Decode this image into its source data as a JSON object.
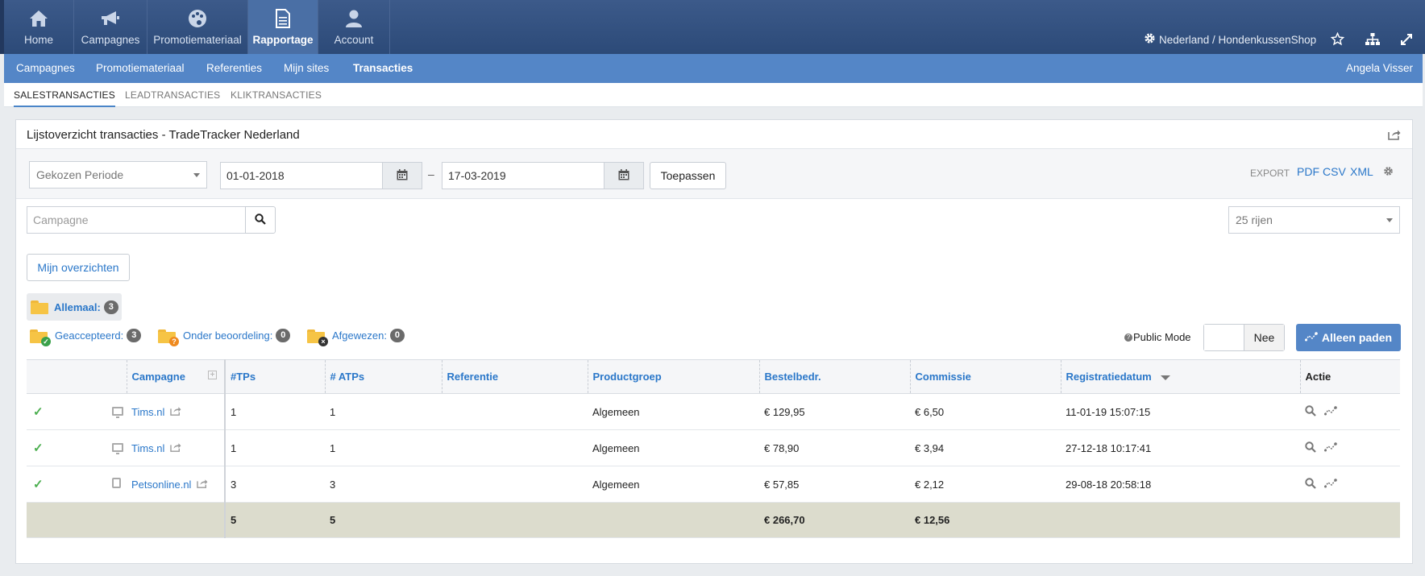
{
  "topnav": {
    "items": [
      {
        "label": "Home",
        "icon": "home-icon"
      },
      {
        "label": "Campagnes",
        "icon": "megaphone-icon"
      },
      {
        "label": "Promotiemateriaal",
        "icon": "palette-icon"
      },
      {
        "label": "Rapportage",
        "icon": "document-icon"
      },
      {
        "label": "Account",
        "icon": "user-icon"
      }
    ],
    "active": "Rapportage",
    "site_selector": "Nederland / HondenkussenShop"
  },
  "subnav": {
    "items": [
      "Campagnes",
      "Promotiemateriaal",
      "Referenties",
      "Mijn sites",
      "Transacties"
    ],
    "active": "Transacties",
    "user": "Angela Visser"
  },
  "tabs": [
    "SALESTRANSACTIES",
    "LEADTRANSACTIES",
    "KLIKTRANSACTIES"
  ],
  "panel": {
    "title": "Lijstoverzicht transacties - TradeTracker Nederland"
  },
  "filters": {
    "period": "Gekozen Periode",
    "date_from": "01-01-2018",
    "date_sep": "–",
    "date_to": "17-03-2019",
    "apply": "Toepassen",
    "export_label": "EXPORT",
    "export_pdf": "PDF",
    "export_csv": "CSV",
    "export_xml": "XML",
    "campaign_placeholder": "Campagne",
    "rows": "25 rijen",
    "my_overviews": "Mijn overzichten"
  },
  "statuses": {
    "all": {
      "label": "Allemaal:",
      "count": "3"
    },
    "accepted": {
      "label": "Geaccepteerd:",
      "count": "3"
    },
    "pending": {
      "label": "Onder beoordeling:",
      "count": "0"
    },
    "rejected": {
      "label": "Afgewezen:",
      "count": "0"
    }
  },
  "public_mode": {
    "label": "Public Mode",
    "value": "Nee"
  },
  "paths_button": "Alleen paden",
  "table": {
    "headers": [
      "Campagne",
      "#TPs",
      "# ATPs",
      "Referentie",
      "Productgroep",
      "Bestelbedr.",
      "Commissie",
      "Registratiedatum",
      "Actie"
    ],
    "rows": [
      {
        "device": "desktop",
        "campaign": "Tims.nl",
        "tps": "1",
        "atps": "1",
        "ref": "",
        "group": "Algemeen",
        "amount": "€ 129,95",
        "commission": "€ 6,50",
        "date": "11-01-19 15:07:15"
      },
      {
        "device": "desktop",
        "campaign": "Tims.nl",
        "tps": "1",
        "atps": "1",
        "ref": "",
        "group": "Algemeen",
        "amount": "€ 78,90",
        "commission": "€ 3,94",
        "date": "27-12-18 10:17:41"
      },
      {
        "device": "tablet",
        "campaign": "Petsonline.nl",
        "tps": "3",
        "atps": "3",
        "ref": "",
        "group": "Algemeen",
        "amount": "€ 57,85",
        "commission": "€ 2,12",
        "date": "29-08-18 20:58:18"
      }
    ],
    "totals": {
      "tps": "5",
      "atps": "5",
      "amount": "€ 266,70",
      "commission": "€ 12,56"
    }
  }
}
